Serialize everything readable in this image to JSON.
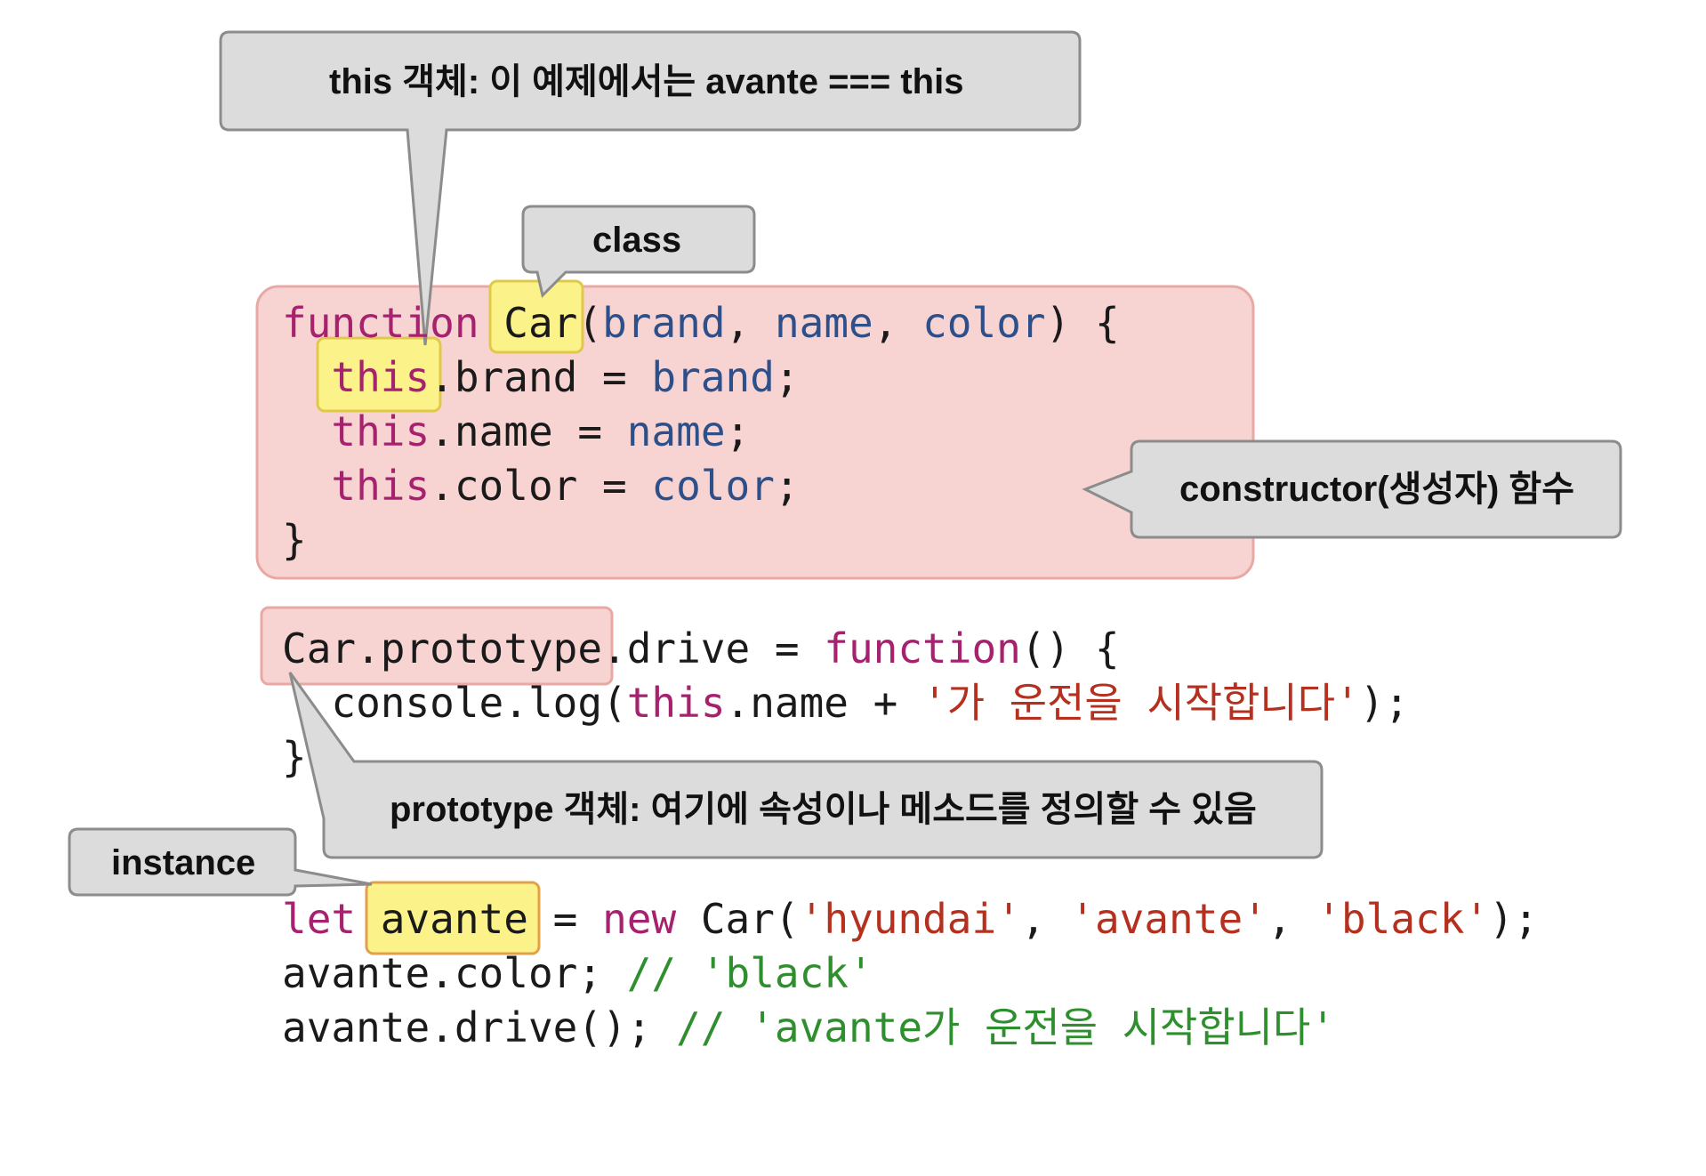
{
  "callouts": {
    "this_object": "this 객체: 이 예제에서는 avante === this",
    "class": "class",
    "constructor": "constructor(생성자) 함수",
    "prototype_object": "prototype 객체: 여기에 속성이나 메소드를 정의할 수 있음",
    "instance": "instance"
  },
  "code": {
    "line1": {
      "kw": "function",
      "name": "Car",
      "open": "(",
      "p1": "brand",
      "sep1": ", ",
      "p2": "name",
      "sep2": ", ",
      "p3": "color",
      "close": ") {"
    },
    "line2": {
      "kw": "this",
      "rest": ".brand = ",
      "val": "brand",
      "end": ";"
    },
    "line3": {
      "kw": "this",
      "rest": ".name = ",
      "val": "name",
      "end": ";"
    },
    "line4": {
      "kw": "this",
      "rest": ".color = ",
      "val": "color",
      "end": ";"
    },
    "line5": "}",
    "line6": {
      "head": "Car.prototype",
      "rest": ".drive = ",
      "kw": "function",
      "end": "() {"
    },
    "line7": {
      "pre": "console.log(",
      "kw": "this",
      "rest": ".name + ",
      "str": "'가 운전을 시작합니다'",
      "end": ");"
    },
    "line8": "}",
    "line9": {
      "kw": "let",
      "var": "avante",
      "eq": " = ",
      "kw2": "new",
      "call": " Car(",
      "s1": "'hyundai'",
      "c1": ", ",
      "s2": "'avante'",
      "c2": ", ",
      "s3": "'black'",
      "end": ");"
    },
    "line10": {
      "code": "avante.color; ",
      "cmt": "// 'black'"
    },
    "line11": {
      "code": "avante.drive(); ",
      "cmt": "// 'avante가 운전을 시작합니다'"
    }
  }
}
